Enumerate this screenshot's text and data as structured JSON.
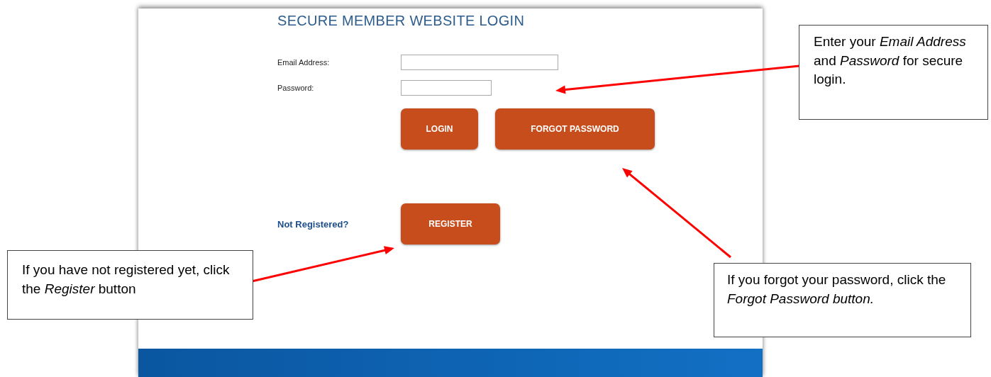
{
  "page": {
    "title": "SECURE MEMBER WEBSITE LOGIN",
    "fields": [
      {
        "label": "Email Address:",
        "kind": "wide"
      },
      {
        "label": "Password:",
        "kind": "short"
      }
    ],
    "buttons": [
      {
        "label": "LOGIN"
      },
      {
        "label": "FORGOT PASSWORD"
      }
    ],
    "register_prompt": "Not Registered?",
    "register_button": "REGISTER"
  },
  "callouts": [
    {
      "text": "Enter your *Email Address* and *Password* for secure login.",
      "kind": "credentials"
    },
    {
      "text": "If you forgot your password, click the *Forgot Password button.*",
      "kind": "forgot"
    },
    {
      "text": "If you have not registered yet, click the *Register* button",
      "kind": "register"
    }
  ]
}
